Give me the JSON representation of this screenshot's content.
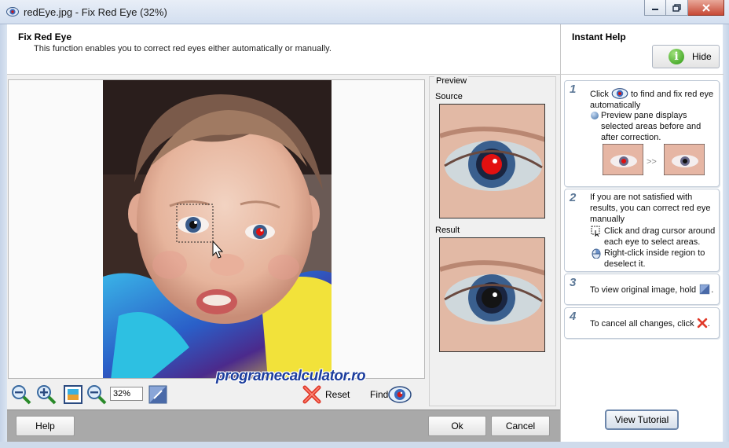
{
  "window": {
    "title": "redEye.jpg - Fix Red Eye (32%)"
  },
  "header": {
    "title": "Fix Red Eye",
    "description": "This function enables you to correct red eyes either automatically or manually."
  },
  "help": {
    "title": "Instant Help",
    "hide_label": "Hide",
    "steps": [
      {
        "num": "1",
        "line1a": "Click",
        "line1b": "to find and fix red eye",
        "line2": "automatically",
        "bullet1": "Preview pane displays selected areas before and after correction.",
        "arrows": ">>"
      },
      {
        "num": "2",
        "text": "If you are not satisfied with results, you can correct red eye manually",
        "bullet1": "Click and drag cursor around each eye to select areas.",
        "bullet2": "Right-click inside region to deselect it."
      },
      {
        "num": "3",
        "text": "To view original image, hold",
        "suffix": "."
      },
      {
        "num": "4",
        "text": "To cancel all changes, click",
        "suffix": "."
      }
    ],
    "tutorial_label": "View Tutorial"
  },
  "preview": {
    "title": "Preview",
    "source_label": "Source",
    "result_label": "Result"
  },
  "toolbar": {
    "zoom_value": "32%",
    "reset_label": "Reset",
    "find_label": "Find"
  },
  "watermark": "programecalculator.ro",
  "buttons": {
    "help": "Help",
    "ok": "Ok",
    "cancel": "Cancel"
  },
  "colors": {
    "accent": "#5b7796",
    "redeye": "#e01010",
    "bottom_bar": "#a9a9a9"
  }
}
